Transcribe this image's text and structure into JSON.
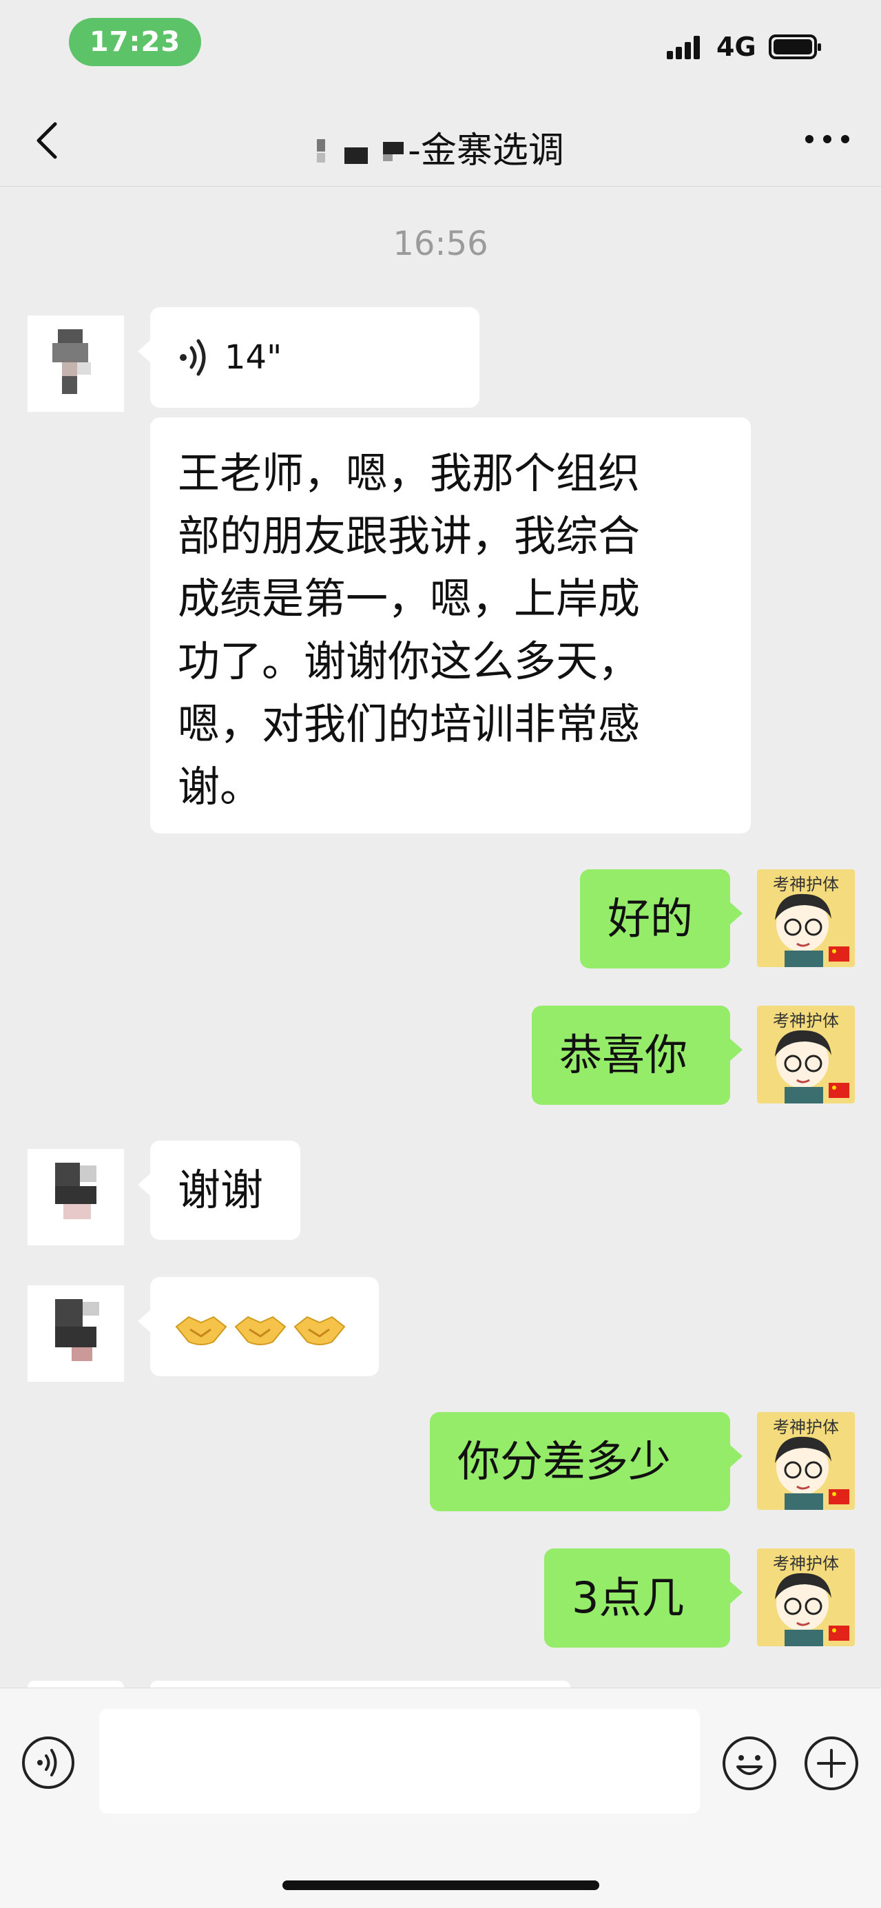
{
  "status_bar": {
    "time": "17:23",
    "network": "4G"
  },
  "header": {
    "title_suffix": "-金寨选调"
  },
  "timestamp": "16:56",
  "messages": {
    "voice_duration": "14\"",
    "transcript": "王老师，嗯，我那个组织部的朋友跟我讲，我综合成绩是第一，嗯，上岸成功了。谢谢你这么多天，嗯，对我们的培训非常感谢。",
    "transcript_lines": [
      "王老师，嗯，我那个组织",
      "部的朋友跟我讲，我综合",
      "成绩是第一，嗯，上岸成",
      "功了。谢谢你这么多天，",
      "嗯，对我们的培训非常感",
      "谢。"
    ],
    "m1": "好的",
    "m2": "恭喜你",
    "m3": "谢谢",
    "m4_emoji": "🤝🤝🤝",
    "m5": "你分差多少",
    "m6": "3点几"
  },
  "avatar_right_text": "考神护体",
  "colors": {
    "outgoing": "#95ec69",
    "incoming": "#ffffff",
    "background": "#ededed",
    "time_pill": "#5cc368"
  }
}
